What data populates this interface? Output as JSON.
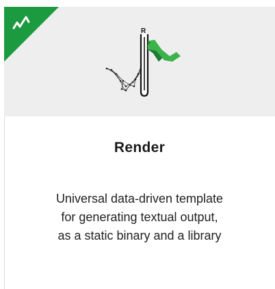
{
  "card": {
    "title": "Render",
    "description_lines": [
      "Universal data-driven template",
      "for generating textual output,",
      "as a static binary and a library"
    ],
    "logo_letter": "R",
    "logo_icon": "render-logo-icon",
    "ribbon_icon": "checkmark-icon",
    "colors": {
      "ribbon": "#1c9a3f",
      "flag_light": "#3cb34a",
      "flag_dark": "#1e7a34",
      "banner": "#eeeeee",
      "text": "#1a1a1a"
    }
  }
}
